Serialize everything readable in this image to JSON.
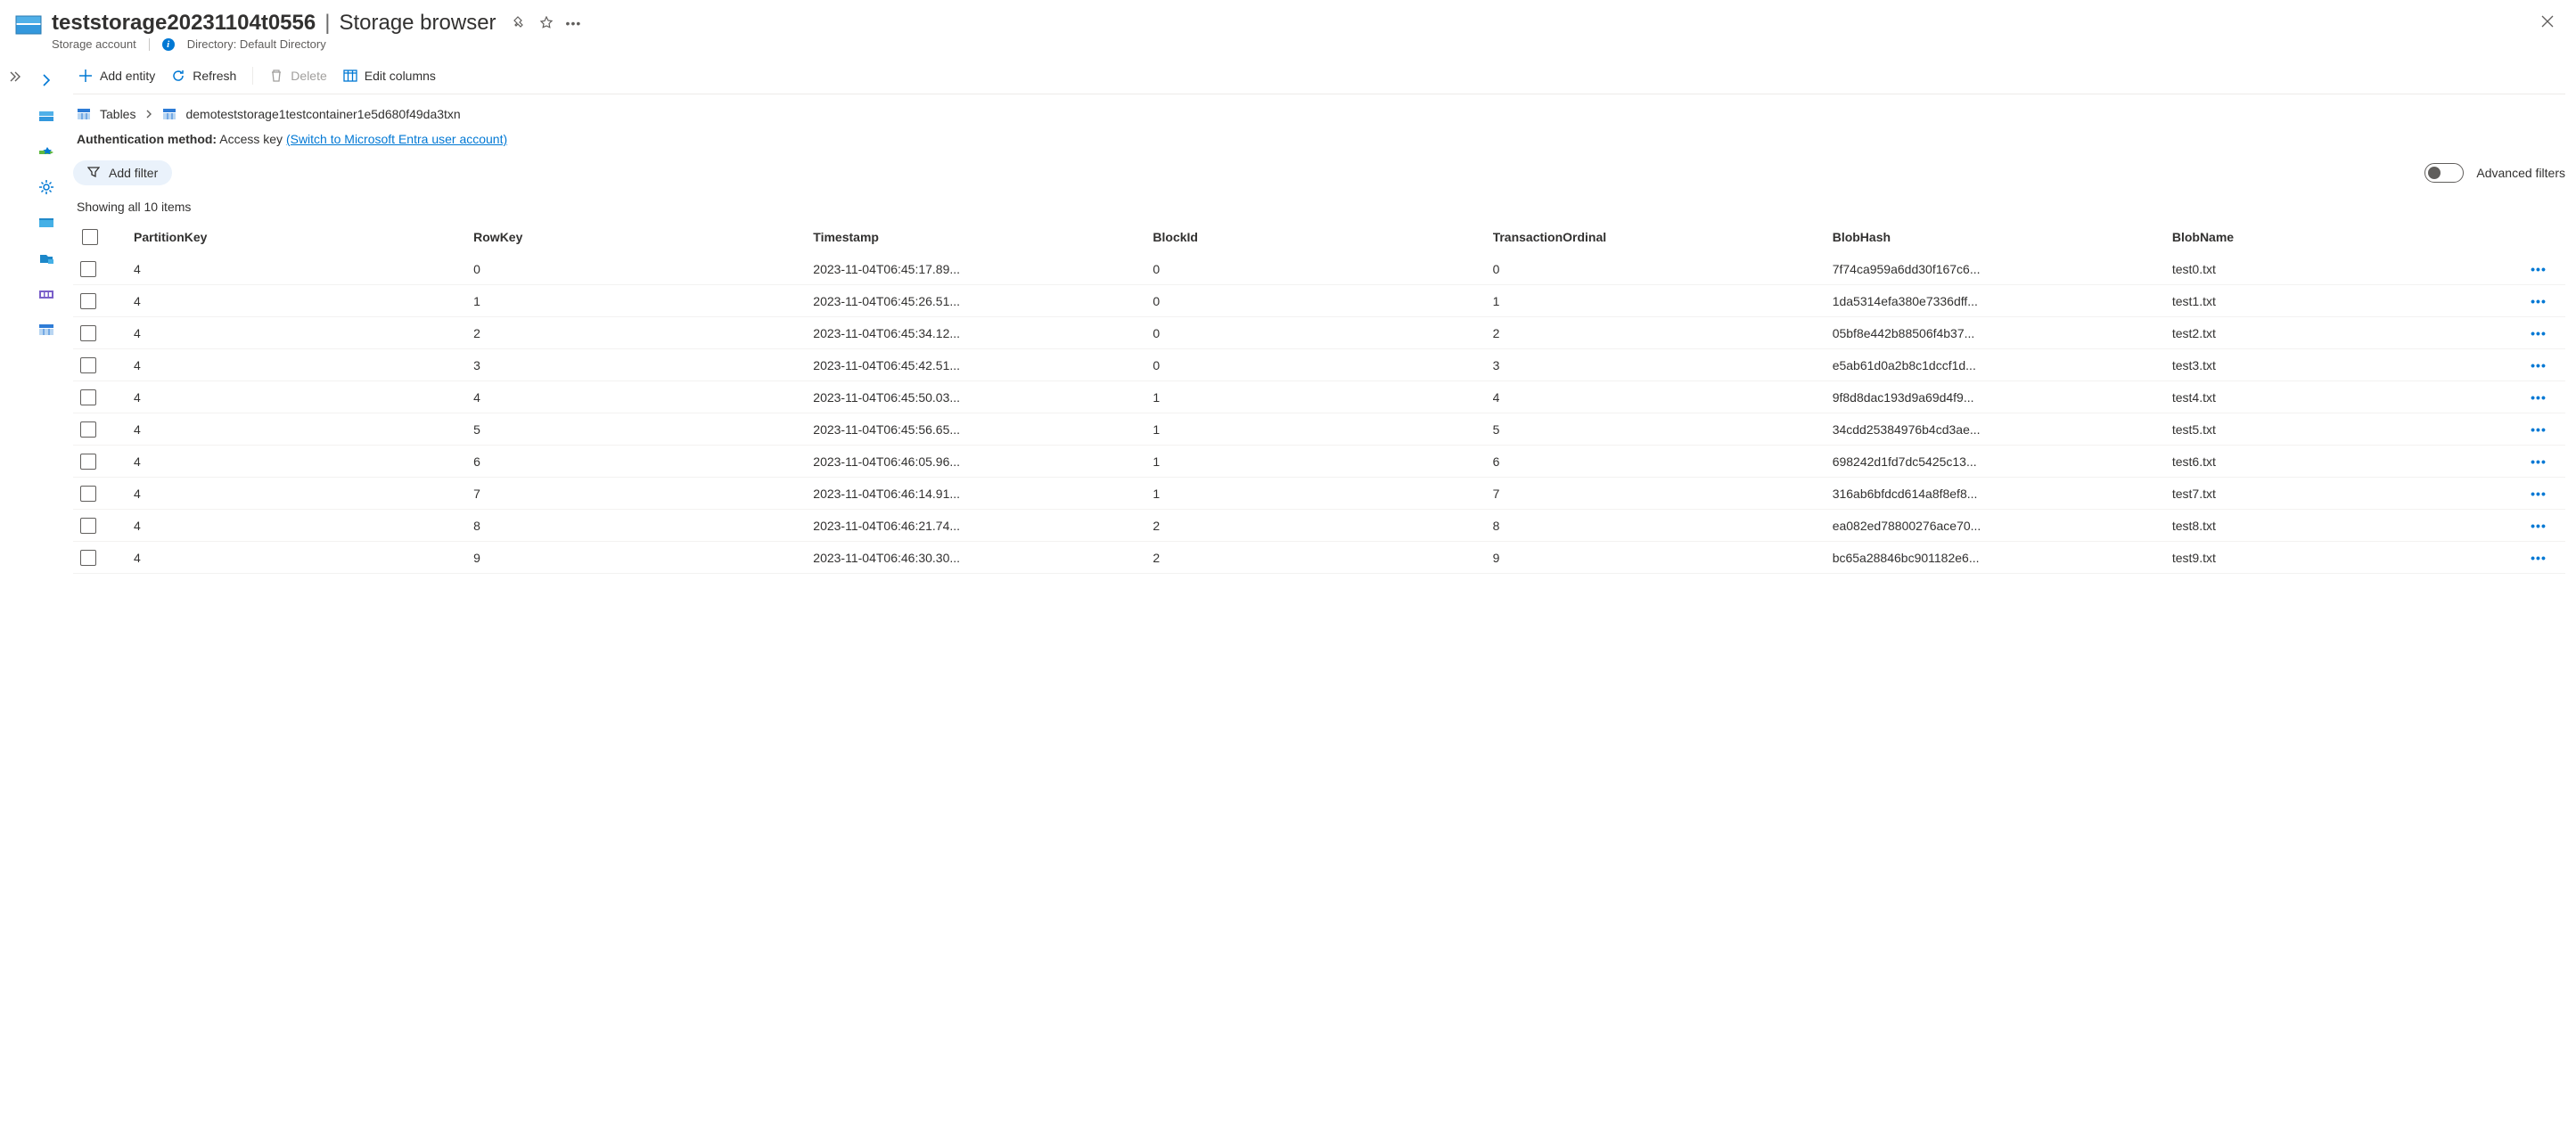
{
  "header": {
    "title": "teststorage20231104t0556",
    "subtitle": "Storage browser",
    "resource_type": "Storage account",
    "directory_label": "Directory: Default Directory"
  },
  "toolbar": {
    "add_entity": "Add entity",
    "refresh": "Refresh",
    "delete": "Delete",
    "edit_columns": "Edit columns"
  },
  "breadcrumb": {
    "root": "Tables",
    "current": "demoteststorage1testcontainer1e5d680f49da3txn"
  },
  "auth": {
    "label": "Authentication method:",
    "value": "Access key",
    "switch_link": "(Switch to Microsoft Entra user account)"
  },
  "filter": {
    "add_filter": "Add filter",
    "advanced_filters": "Advanced filters"
  },
  "count_text": "Showing all 10 items",
  "columns": [
    "PartitionKey",
    "RowKey",
    "Timestamp",
    "BlockId",
    "TransactionOrdinal",
    "BlobHash",
    "BlobName"
  ],
  "rows": [
    {
      "PartitionKey": "4",
      "RowKey": "0",
      "Timestamp": "2023-11-04T06:45:17.89...",
      "BlockId": "0",
      "TransactionOrdinal": "0",
      "BlobHash": "7f74ca959a6dd30f167c6...",
      "BlobName": "test0.txt"
    },
    {
      "PartitionKey": "4",
      "RowKey": "1",
      "Timestamp": "2023-11-04T06:45:26.51...",
      "BlockId": "0",
      "TransactionOrdinal": "1",
      "BlobHash": "1da5314efa380e7336dff...",
      "BlobName": "test1.txt"
    },
    {
      "PartitionKey": "4",
      "RowKey": "2",
      "Timestamp": "2023-11-04T06:45:34.12...",
      "BlockId": "0",
      "TransactionOrdinal": "2",
      "BlobHash": "05bf8e442b88506f4b37...",
      "BlobName": "test2.txt"
    },
    {
      "PartitionKey": "4",
      "RowKey": "3",
      "Timestamp": "2023-11-04T06:45:42.51...",
      "BlockId": "0",
      "TransactionOrdinal": "3",
      "BlobHash": "e5ab61d0a2b8c1dccf1d...",
      "BlobName": "test3.txt"
    },
    {
      "PartitionKey": "4",
      "RowKey": "4",
      "Timestamp": "2023-11-04T06:45:50.03...",
      "BlockId": "1",
      "TransactionOrdinal": "4",
      "BlobHash": "9f8d8dac193d9a69d4f9...",
      "BlobName": "test4.txt"
    },
    {
      "PartitionKey": "4",
      "RowKey": "5",
      "Timestamp": "2023-11-04T06:45:56.65...",
      "BlockId": "1",
      "TransactionOrdinal": "5",
      "BlobHash": "34cdd25384976b4cd3ae...",
      "BlobName": "test5.txt"
    },
    {
      "PartitionKey": "4",
      "RowKey": "6",
      "Timestamp": "2023-11-04T06:46:05.96...",
      "BlockId": "1",
      "TransactionOrdinal": "6",
      "BlobHash": "698242d1fd7dc5425c13...",
      "BlobName": "test6.txt"
    },
    {
      "PartitionKey": "4",
      "RowKey": "7",
      "Timestamp": "2023-11-04T06:46:14.91...",
      "BlockId": "1",
      "TransactionOrdinal": "7",
      "BlobHash": "316ab6bfdcd614a8f8ef8...",
      "BlobName": "test7.txt"
    },
    {
      "PartitionKey": "4",
      "RowKey": "8",
      "Timestamp": "2023-11-04T06:46:21.74...",
      "BlockId": "2",
      "TransactionOrdinal": "8",
      "BlobHash": "ea082ed78800276ace70...",
      "BlobName": "test8.txt"
    },
    {
      "PartitionKey": "4",
      "RowKey": "9",
      "Timestamp": "2023-11-04T06:46:30.30...",
      "BlockId": "2",
      "TransactionOrdinal": "9",
      "BlobHash": "bc65a28846bc901182e6...",
      "BlobName": "test9.txt"
    }
  ],
  "colors": {
    "link": "#0078d4",
    "pill": "#eaf2fb"
  }
}
